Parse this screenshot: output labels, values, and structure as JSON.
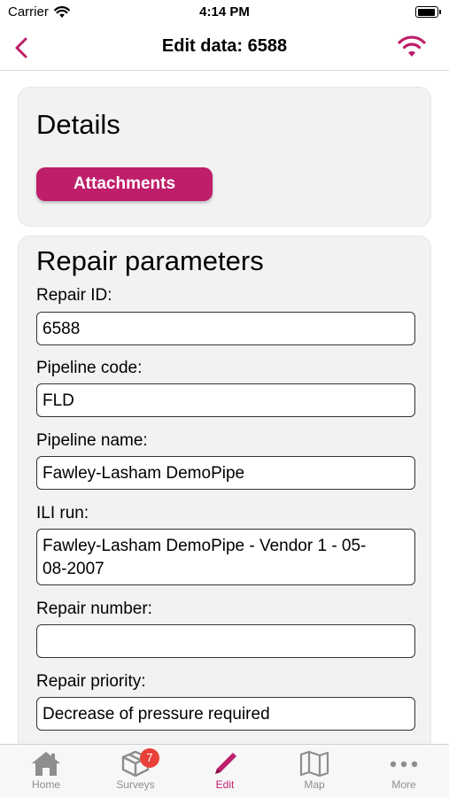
{
  "status_bar": {
    "carrier": "Carrier",
    "time": "4:14 PM"
  },
  "nav": {
    "title": "Edit data: 6588",
    "back_icon": "chevron-left-icon",
    "status_icon": "wifi-icon"
  },
  "details": {
    "title": "Details",
    "attachments_label": "Attachments"
  },
  "repair": {
    "title": "Repair parameters",
    "fields": [
      {
        "label": "Repair ID:",
        "value": "6588"
      },
      {
        "label": "Pipeline code:",
        "value": "FLD"
      },
      {
        "label": "Pipeline name:",
        "value": "Fawley-Lasham DemoPipe"
      },
      {
        "label": "ILI run:",
        "value": "Fawley-Lasham DemoPipe - Vendor 1 - 05-08-2007"
      },
      {
        "label": "Repair number:",
        "value": ""
      },
      {
        "label": "Repair priority:",
        "value": "Decrease of pressure required"
      }
    ]
  },
  "tabs": [
    {
      "label": "Home",
      "icon": "home-icon"
    },
    {
      "label": "Surveys",
      "icon": "box-icon",
      "badge": "7"
    },
    {
      "label": "Edit",
      "icon": "pencil-icon"
    },
    {
      "label": "Map",
      "icon": "map-icon"
    },
    {
      "label": "More",
      "icon": "more-icon"
    }
  ],
  "colors": {
    "accent": "#be1e6a",
    "badge": "#e8413a",
    "card_bg": "#f2f2f2"
  }
}
